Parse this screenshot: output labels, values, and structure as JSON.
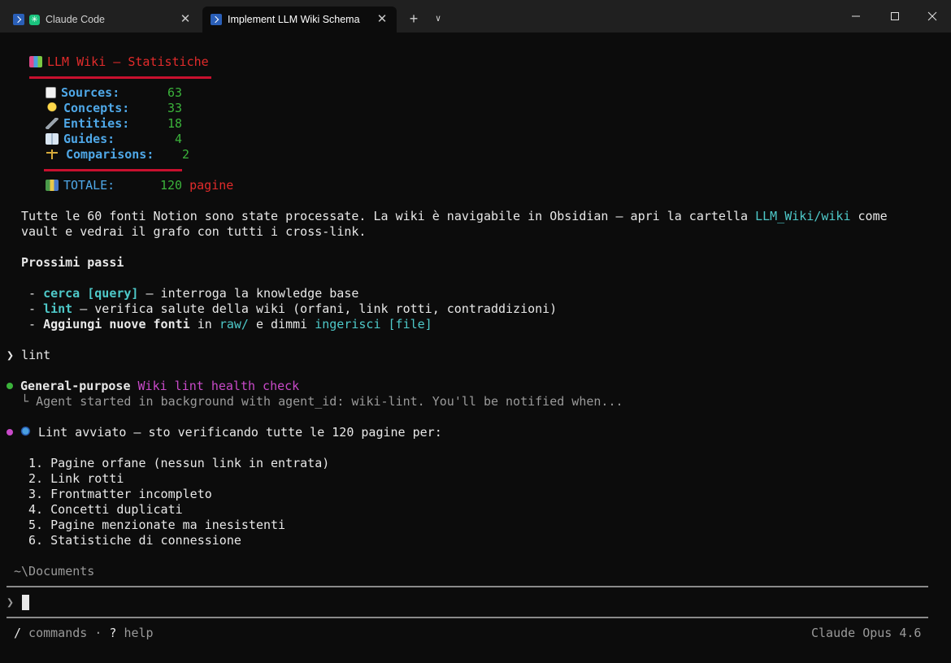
{
  "tabs": [
    {
      "label": "Claude Code",
      "active": false
    },
    {
      "label": "Implement LLM Wiki Schema",
      "active": true
    }
  ],
  "stats": {
    "title": "LLM Wiki — Statistiche",
    "rows": [
      {
        "icon": "document-icon",
        "label": "Sources:",
        "value": "63"
      },
      {
        "icon": "lightbulb-icon",
        "label": "Concepts:",
        "value": "33"
      },
      {
        "icon": "wrench-icon",
        "label": "Entities:",
        "value": "18"
      },
      {
        "icon": "book-icon",
        "label": "Guides:",
        "value": "4"
      },
      {
        "icon": "scale-icon",
        "label": "Comparisons:",
        "value": "2"
      }
    ],
    "total_label": "TOTALE:",
    "total_value": "120",
    "total_unit": "pagine"
  },
  "summary": {
    "line1_pre": "Tutte le 60 fonti Notion sono state processate. La wiki è navigabile in Obsidian — apri la cartella ",
    "line1_link": "LLM_Wiki/wiki",
    "line1_post": " come",
    "line2": "vault e vedrai il grafo con tutti i cross-link."
  },
  "next_steps": {
    "heading": "Prossimi passi",
    "item1_cmd": "cerca [query]",
    "item1_text": " — interroga la knowledge base",
    "item2_cmd": "lint",
    "item2_text": " — verifica salute della wiki (orfani, link rotti, contraddizioni)",
    "item3_bold": "Aggiungi nuove fonti",
    "item3_mid": " in ",
    "item3_path": "raw/",
    "item3_mid2": " e dimmi ",
    "item3_cmd": "ingerisci [file]"
  },
  "prompt_cmd": "lint",
  "agent": {
    "type": "General-purpose",
    "task": "Wiki lint health check",
    "status": "Agent started in background with agent_id: wiki-lint. You'll be notified when..."
  },
  "lint": {
    "intro": "Lint avviato — sto verificando tutte le 120 pagine per:",
    "items": [
      "1. Pagine orfane (nessun link in entrata)",
      "2. Link rotti",
      "3. Frontmatter incompleto",
      "4. Concetti duplicati",
      "5. Pagine menzionate ma inesistenti",
      "6. Statistiche di connessione"
    ]
  },
  "cwd": "~\\Documents",
  "footer": {
    "hint_slash": "/",
    "hint_commands": " commands · ",
    "hint_q": "?",
    "hint_help": " help",
    "model": "Claude Opus 4.6"
  },
  "colors": {
    "accent_red": "#e22b2b",
    "label_blue": "#4fa8e8",
    "value_green": "#3bb33b",
    "command_cyan": "#4ec9c9",
    "task_magenta": "#c94ac9"
  }
}
